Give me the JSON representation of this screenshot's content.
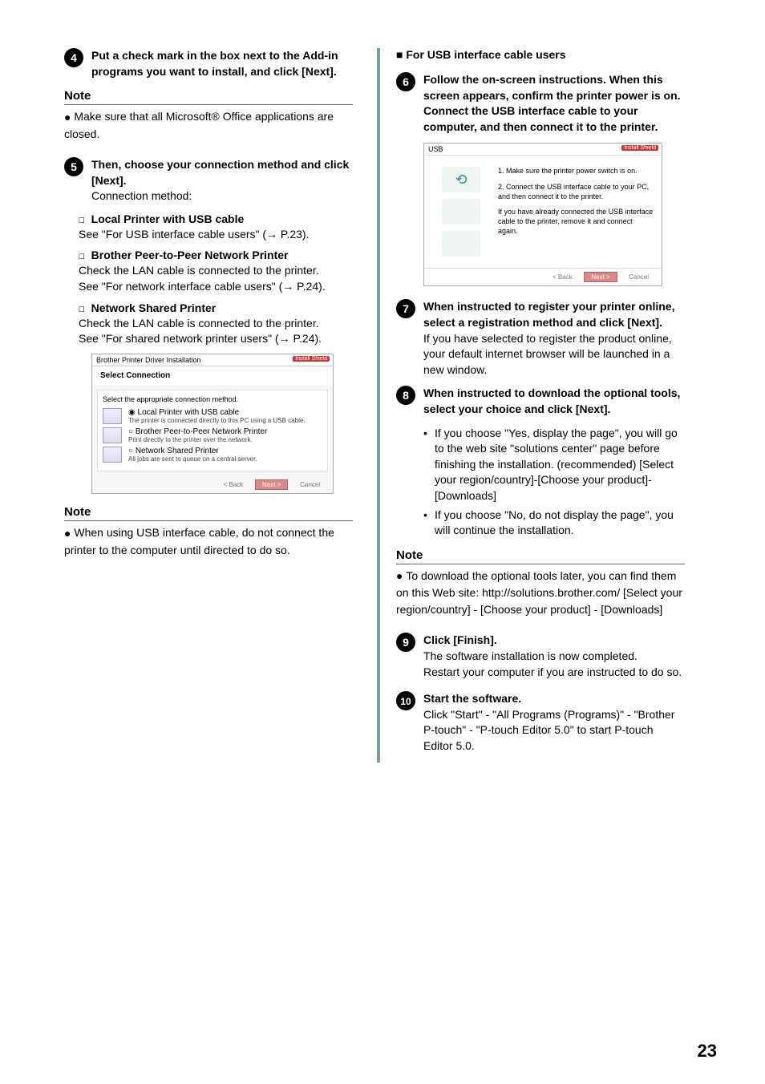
{
  "pageNumber": "23",
  "left": {
    "step4": "Put a check mark in the box next to the Add-in programs you want to install, and click [Next].",
    "note1_header": "Note",
    "note1_body": "Make sure that all Microsoft® Office applications are closed.",
    "step5_bold": "Then, choose your connection method and click [Next].",
    "step5_text": "Connection method:",
    "cm1_title": "Local Printer with USB cable",
    "cm1_text": "See \"For USB interface cable users\" (→ P.23).",
    "cm2_title": "Brother Peer-to-Peer Network Printer",
    "cm2_text1": "Check the LAN cable is connected to the printer.",
    "cm2_text2": "See \"For network interface cable users\" (→ P.24).",
    "cm3_title": "Network Shared Printer",
    "cm3_text1": "Check the LAN cable is connected to the printer.",
    "cm3_text2": "See \"For shared network printer users\" (→ P.24).",
    "dialog": {
      "winTitle": "Brother Printer Driver Installation",
      "heading": "Select Connection",
      "instruction": "Select the appropriate connection method.",
      "opt1": "Local Printer with USB cable",
      "opt1_sub": "The printer is connected directly to this PC using a USB cable.",
      "opt2": "Brother Peer-to-Peer Network Printer",
      "opt2_sub": "Print directly to the printer over the network.",
      "opt3": "Network Shared Printer",
      "opt3_sub": "All jobs are sent to queue on a central server.",
      "btn_back": "< Back",
      "btn_next": "Next >",
      "btn_cancel": "Cancel",
      "tag": "Install Shield"
    },
    "note2_header": "Note",
    "note2_body": "When using USB interface cable, do not connect the printer to the computer until directed to do so."
  },
  "right": {
    "heading": "For USB interface cable users",
    "step6": "Follow the on-screen instructions. When this screen appears, confirm the printer power is on. Connect the USB interface cable to your computer, and then connect it to the printer.",
    "usb_dialog": {
      "top": "USB",
      "tag": "Install Shield",
      "t1": "1. Make sure the printer power switch is on.",
      "t2": "2. Connect the USB interface cable to your PC, and then connect it to the printer.",
      "t3": "If you have already connected the USB interface cable to the printer, remove it and connect again.",
      "btn_back": "< Back",
      "btn_next": "Next >",
      "btn_cancel": "Cancel"
    },
    "step7_bold": "When instructed to register your printer online, select a registration method and click [Next].",
    "step7_text": "If you have selected to register the product online, your default internet browser will be launched in a new window.",
    "step8_bold": "When instructed to download the optional tools, select your choice and click [Next].",
    "step8_b1": "If you choose \"Yes, display the page\", you will go to the web site \"solutions center\" page before finishing the installation. (recommended) [Select your region/country]-[Choose your product]-[Downloads]",
    "step8_b2": "If you choose \"No, do not display the page\", you will continue the installation.",
    "note3_header": "Note",
    "note3_body": "To download the optional tools later, you can find them on this Web site: http://solutions.brother.com/ [Select your region/country] - [Choose your product] - [Downloads]",
    "step9_bold": "Click [Finish].",
    "step9_text": "The software installation is now completed.\nRestart your computer if you are instructed to do so.",
    "step10_bold": "Start the software.",
    "step10_text": "Click \"Start\" - \"All Programs (Programs)\" - \"Brother P-touch\" - \"P-touch Editor 5.0\" to start P-touch Editor 5.0."
  }
}
